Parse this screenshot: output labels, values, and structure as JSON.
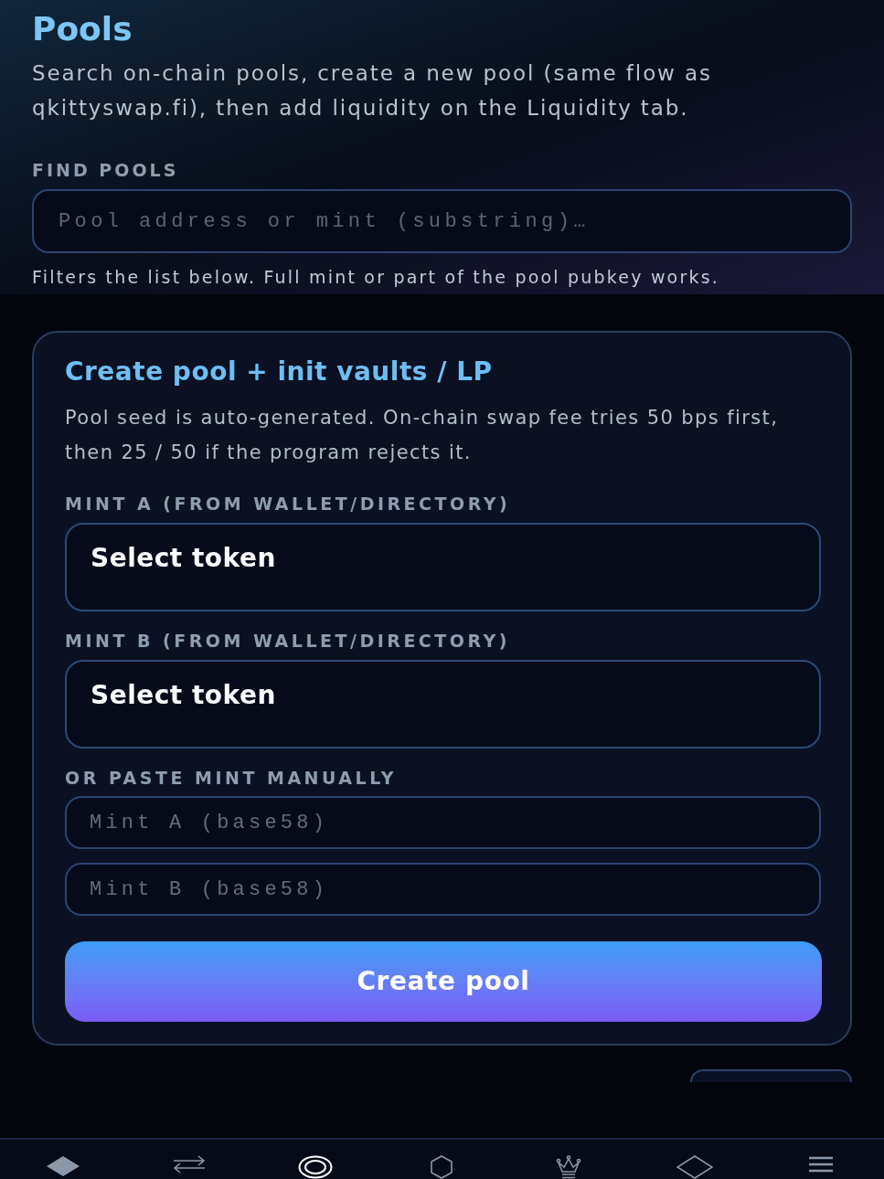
{
  "page": {
    "title": "Pools",
    "description": "Search on-chain pools, create a new pool (same flow as qkittyswap.fi), then add liquidity on the Liquidity tab."
  },
  "find_pools": {
    "label": "FIND POOLS",
    "placeholder": "Pool address or mint (substring)…",
    "hint": "Filters the list below. Full mint or part of the pool pubkey works."
  },
  "create_pool": {
    "title": "Create pool + init vaults / LP",
    "description": "Pool seed is auto-generated. On-chain swap fee tries 50 bps first, then 25 / 50 if the program rejects it.",
    "selects": [
      {
        "label": "MINT A (FROM WALLET/DIRECTORY)",
        "value": "Select token"
      },
      {
        "label": "MINT B (FROM WALLET/DIRECTORY)",
        "value": "Select token"
      }
    ],
    "manual": {
      "label": "OR PASTE MINT MANUALLY",
      "fields": [
        {
          "placeholder": "Mint A (base58)"
        },
        {
          "placeholder": "Mint B (base58)"
        }
      ]
    },
    "button": "Create pool"
  },
  "bottom_nav": [
    {
      "selected": false
    },
    {
      "selected": false
    },
    {
      "selected": true
    },
    {
      "selected": false
    },
    {
      "selected": false
    },
    {
      "selected": false
    },
    {
      "selected": false
    }
  ]
}
